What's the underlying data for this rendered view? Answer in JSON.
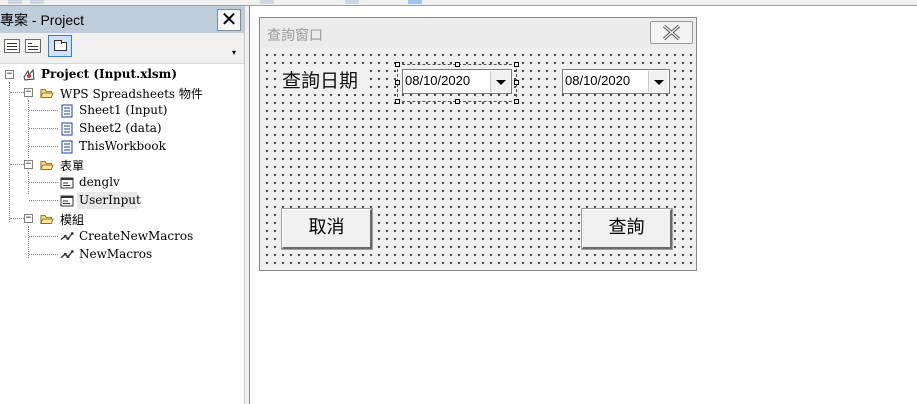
{
  "explorer": {
    "title": "專案 - Project",
    "close_glyph": "✕",
    "toolbar": {
      "view_code_icon": "view-code-icon",
      "view_object_icon": "view-object-icon",
      "toggle_folders_icon": "folder-icon",
      "dropdown_glyph": "▾"
    },
    "tree": {
      "project": "Project (Input.xlsm)",
      "group_objects": "WPS Spreadsheets 物件",
      "sheet1": "Sheet1 (Input)",
      "sheet2": "Sheet2 (data)",
      "thisworkbook": "ThisWorkbook",
      "group_forms": "表單",
      "form1": "denglv",
      "form2": "UserInput",
      "group_modules": "模組",
      "module1": "CreateNewMacros",
      "module2": "NewMacros",
      "collapse_glyph": "−"
    }
  },
  "form": {
    "title": "查詢窗口",
    "date_label": "查詢日期",
    "start_date": "08/10/2020",
    "end_date": "08/10/2020",
    "cancel_label": "取消",
    "query_label": "查詢"
  },
  "colors": {
    "explorer_title_bg": "#bfcddb",
    "selected_toolbar_button": "#cfe3fb",
    "form_bg": "#f0f0f0"
  }
}
